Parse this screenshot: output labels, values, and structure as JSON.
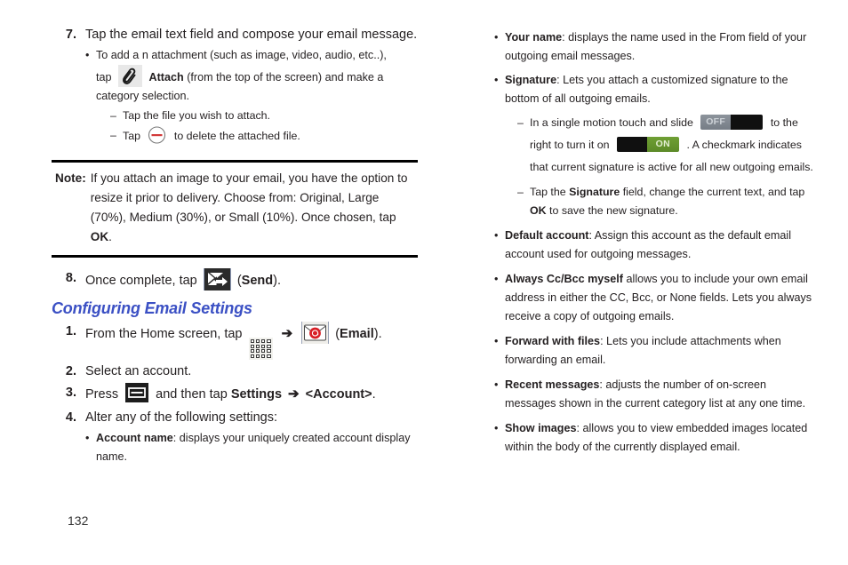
{
  "page": {
    "number": "132",
    "accent_heading_color": "#3b50c4",
    "toggle_on_color": "#6f9f34",
    "toggle_off_color": "#8d949c"
  },
  "left_column": {
    "step7": {
      "num": "7.",
      "text": "Tap the email text field and compose your email message.",
      "bullet": {
        "part1": "To add a n attachment (such as image, video, audio, etc..),",
        "part2": "tap",
        "attach_label": "Attach",
        "part3": "(from the top of the screen) and make a category selection.",
        "dashes": [
          {
            "mark": "–",
            "text": "Tap the file you wish to attach."
          },
          {
            "mark": "–",
            "pre": "Tap",
            "post": "to delete the attached file."
          }
        ]
      }
    },
    "note": {
      "label": "Note:",
      "pre": "If you attach an image to your email, you have the option to resize it prior to delivery. Choose from: Original, Large (70%), Medium (30%), or Small (10%). Once chosen, tap",
      "bold_ok": "OK",
      "post": "."
    },
    "step8": {
      "num": "8.",
      "pre": "Once complete, tap",
      "send_paren_open": "(",
      "send_label": "Send",
      "send_paren_close": ")."
    },
    "section_heading": "Configuring Email Settings",
    "step1": {
      "num": "1.",
      "pre": "From the Home screen, tap",
      "arrow": "➔",
      "paren_open": "(",
      "email_label": "Email",
      "paren_close": ")."
    },
    "step2": {
      "num": "2.",
      "text": "Select an account."
    },
    "step3": {
      "num": "3.",
      "pre": "Press",
      "mid": "and then tap",
      "settings_label": "Settings",
      "arrow": "➔",
      "account_label": "<Account>",
      "post": "."
    },
    "step4": {
      "num": "4.",
      "text": "Alter any of the following settings:",
      "bullet": {
        "term": "Account name",
        "desc": ": displays your uniquely created account display name."
      }
    }
  },
  "right_column": {
    "items": [
      {
        "term": "Your name",
        "desc": ": displays the name used in the From field of your outgoing email messages."
      },
      {
        "term": "Signature",
        "desc": ": Lets you attach a customized signature to the bottom of all outgoing emails.",
        "dashes": [
          {
            "mark": "–",
            "pre": "In a single motion touch and slide",
            "toggle_off_label": "OFF",
            "mid": "to the right to turn it on",
            "toggle_on_label": "ON",
            "post": ". A checkmark indicates that current signature is active for all new outgoing emails."
          },
          {
            "mark": "–",
            "pre": "Tap the",
            "bold1": "Signature",
            "mid": "field, change the current text, and tap",
            "bold2": "OK",
            "post": "to save the new signature."
          }
        ]
      },
      {
        "term": "Default account",
        "desc": ": Assign this account as the default email account used for outgoing messages."
      },
      {
        "term": "Always Cc/Bcc myself",
        "desc": " allows you to include your own email address in either the CC, Bcc, or None fields. Lets you always receive a copy of outgoing emails."
      },
      {
        "term": "Forward with files",
        "desc": ": Lets you include attachments when forwarding an email."
      },
      {
        "term": "Recent messages",
        "desc": ": adjusts the number of on-screen messages shown in the current category list at any one time."
      },
      {
        "term": "Show images",
        "desc": ": allows you to view embedded images located within the body of the currently displayed email."
      }
    ]
  },
  "icons": {
    "attach": "paperclip-icon",
    "delete": "minus-circle-icon",
    "send": "send-envelope-icon",
    "apps": "apps-grid-icon",
    "email": "email-envelope-icon",
    "menu": "menu-key-icon"
  }
}
